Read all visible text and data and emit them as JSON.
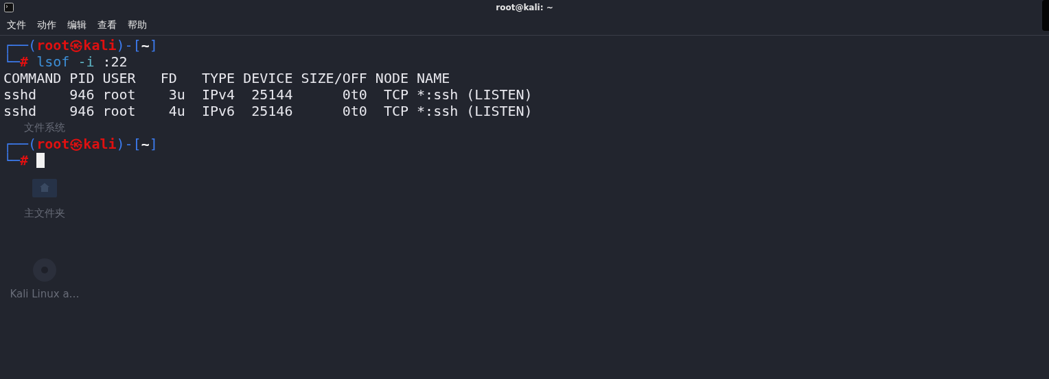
{
  "window": {
    "title": "root@kali: ~"
  },
  "menu": [
    "文件",
    "动作",
    "编辑",
    "查看",
    "帮助"
  ],
  "desktop_icons": [
    {
      "kind": "label",
      "label": "文件系统"
    },
    {
      "kind": "folder",
      "label": "主文件夹"
    },
    {
      "kind": "disc",
      "label": "Kali Linux a…"
    }
  ],
  "terminal": [
    {
      "kind": "prompt",
      "top": [
        {
          "kind": "frame",
          "text": "┌──("
        },
        {
          "kind": "user",
          "text": "root㉿kali"
        },
        {
          "kind": "frame",
          "text": ")-["
        },
        {
          "kind": "path",
          "text": "~"
        },
        {
          "kind": "frame",
          "text": "]"
        }
      ],
      "bottom": [
        {
          "kind": "frame",
          "text": "└─"
        },
        {
          "kind": "user",
          "text": "#"
        },
        {
          "kind": "command",
          "text": " lsof"
        },
        {
          "kind": "option",
          "text": " -i"
        },
        {
          "kind": "plain",
          "text": " :22"
        }
      ]
    },
    {
      "kind": "output",
      "text": "COMMAND PID USER   FD   TYPE DEVICE SIZE/OFF NODE NAME"
    },
    {
      "kind": "output",
      "text": "sshd    946 root    3u  IPv4  25144      0t0  TCP *:ssh (LISTEN)"
    },
    {
      "kind": "output",
      "text": "sshd    946 root    4u  IPv6  25146      0t0  TCP *:ssh (LISTEN)"
    },
    {
      "kind": "blank"
    },
    {
      "kind": "prompt",
      "top": [
        {
          "kind": "frame",
          "text": "┌──("
        },
        {
          "kind": "user",
          "text": "root㉿kali"
        },
        {
          "kind": "frame",
          "text": ")-["
        },
        {
          "kind": "path",
          "text": "~"
        },
        {
          "kind": "frame",
          "text": "]"
        }
      ],
      "bottom": [
        {
          "kind": "frame",
          "text": "└─"
        },
        {
          "kind": "user",
          "text": "#"
        }
      ],
      "cursor": true
    }
  ]
}
